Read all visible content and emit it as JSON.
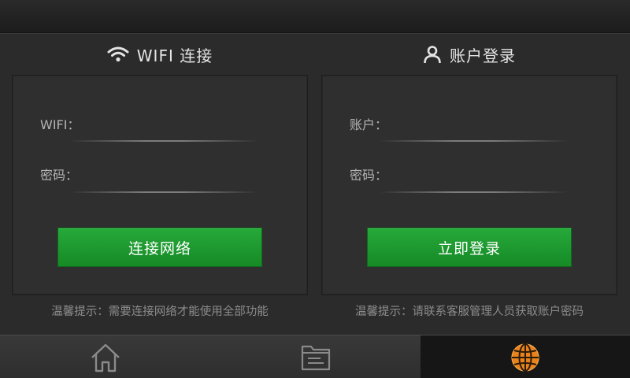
{
  "wifi_panel": {
    "title": "WIFI 连接",
    "title_icon": "wifi-icon",
    "fields": [
      {
        "label": "WIFI：",
        "value": ""
      },
      {
        "label": "密码：",
        "value": ""
      }
    ],
    "button_label": "连接网络",
    "tip": "温馨提示：需要连接网络才能使用全部功能"
  },
  "account_panel": {
    "title": "账户登录",
    "title_icon": "user-icon",
    "fields": [
      {
        "label": "账户：",
        "value": ""
      },
      {
        "label": "密码：",
        "value": ""
      }
    ],
    "button_label": "立即登录",
    "tip": "温馨提示：请联系客服管理人员获取账户密码"
  },
  "bottom_nav": {
    "items": [
      {
        "icon": "home-icon",
        "active": false
      },
      {
        "icon": "folder-icon",
        "active": false
      },
      {
        "icon": "globe-icon",
        "active": true
      }
    ]
  },
  "colors": {
    "accent_green": "#1f9e31",
    "active_icon": "#e8821c",
    "background": "#2b2b2b"
  }
}
